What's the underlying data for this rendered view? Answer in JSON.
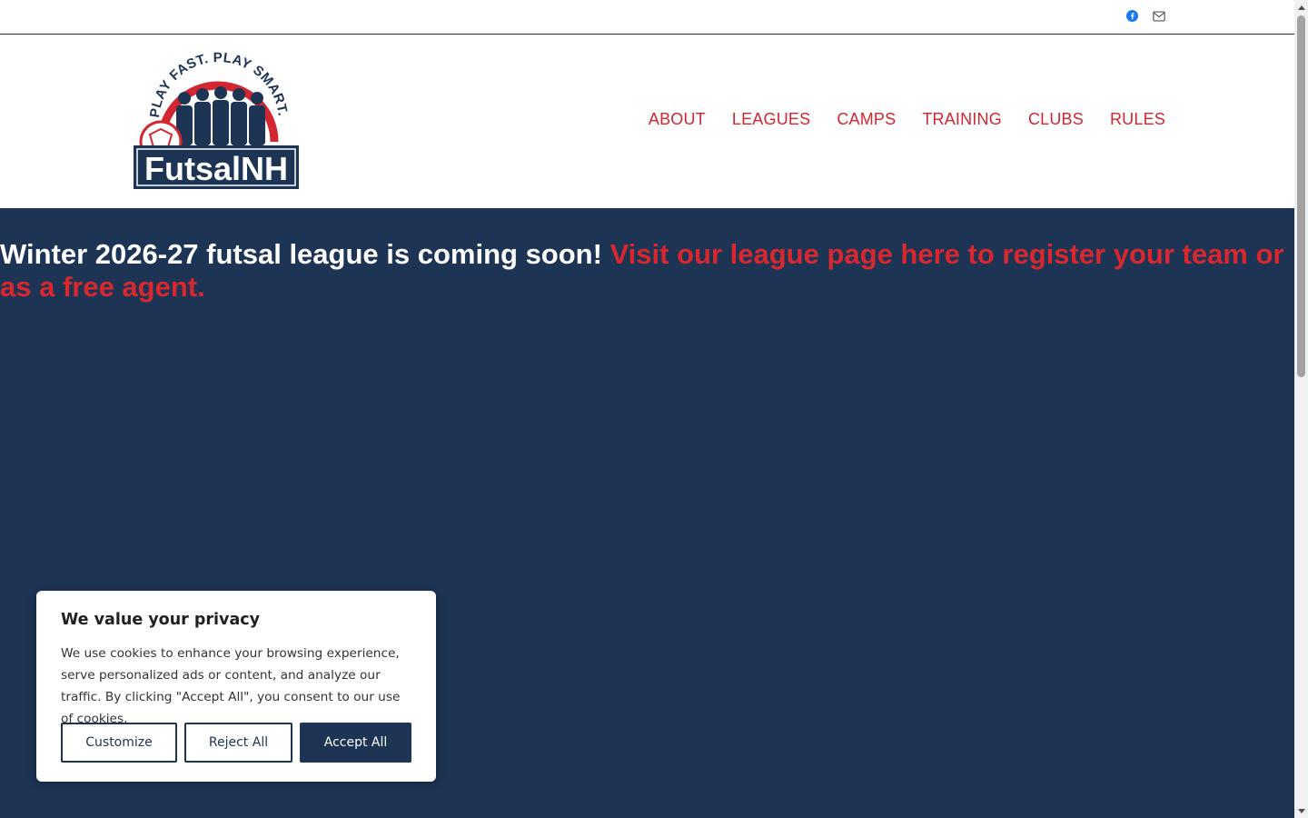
{
  "topbar": {
    "social": [
      {
        "icon": "facebook-icon",
        "color": "#1877f2"
      },
      {
        "icon": "email-icon",
        "color": "#555555"
      }
    ]
  },
  "header": {
    "logo": {
      "tagline": "PLAY FAST. PLAY SMART.",
      "brand": "FutsalNH"
    },
    "nav": [
      "ABOUT",
      "LEAGUES",
      "CAMPS",
      "TRAINING",
      "CLUBS",
      "RULES"
    ]
  },
  "hero": {
    "headline_plain": "Winter 2026-27 futsal league is coming soon! ",
    "headline_link": "Visit our league page here to register your team or as a free agent.",
    "background": "#1d3454",
    "link_color": "#d7282f"
  },
  "cookie_banner": {
    "title": "We value your privacy",
    "body": "We use cookies to enhance your browsing experience, serve personalized ads or content, and analyze our traffic. By clicking \"Accept All\", you consent to our use of cookies.",
    "customize": "Customize",
    "reject": "Reject All",
    "accept": "Accept All"
  },
  "colors": {
    "brand_red": "#d22630",
    "brand_navy": "#1d3454"
  }
}
